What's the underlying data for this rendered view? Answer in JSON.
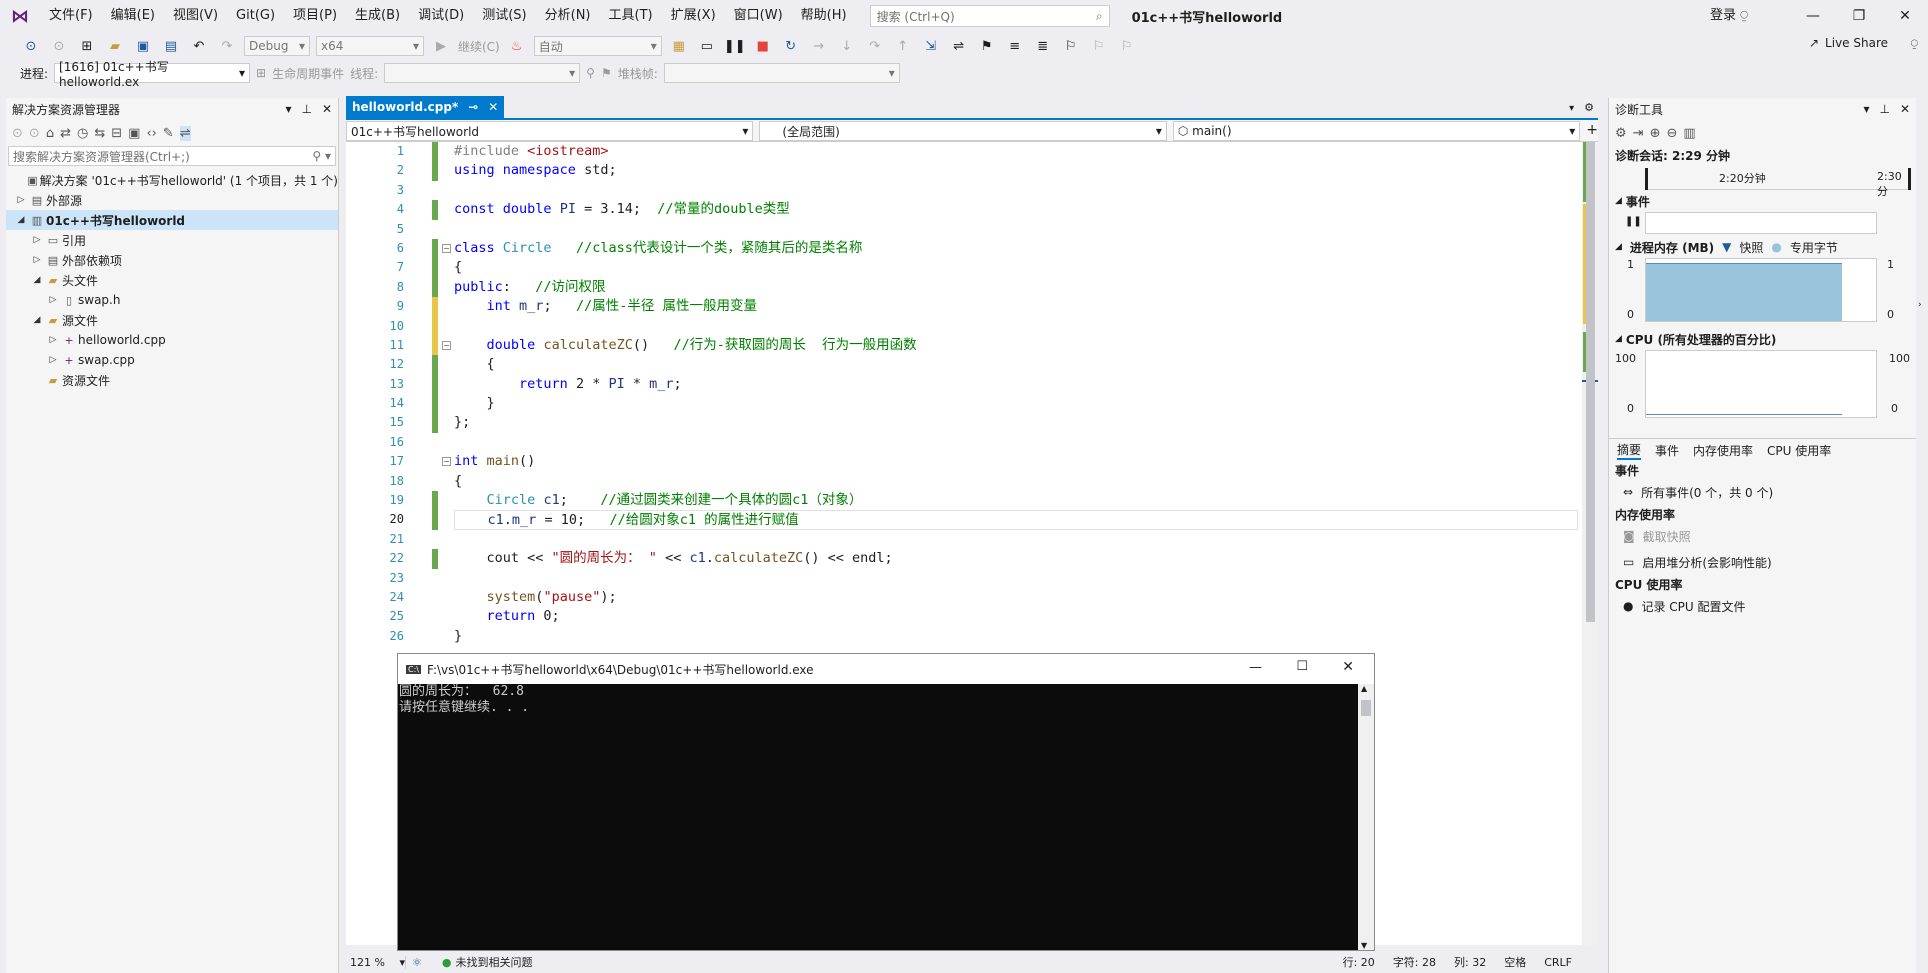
{
  "menu": [
    "文件(F)",
    "编辑(E)",
    "视图(V)",
    "Git(G)",
    "项目(P)",
    "生成(B)",
    "调试(D)",
    "测试(S)",
    "分析(N)",
    "工具(T)",
    "扩展(X)",
    "窗口(W)",
    "帮助(H)"
  ],
  "search": {
    "placeholder": "搜索 (Ctrl+Q)"
  },
  "app_title": "01c++书写helloworld",
  "login": "登录",
  "toolbar": {
    "config": "Debug",
    "platform": "x64",
    "continue": "继续(C)",
    "auto": "自动",
    "live_share": "Live Share"
  },
  "toolbar2": {
    "process_label": "进程:",
    "process_value": "[1616] 01c++书写helloworld.ex",
    "lifecycle": "生命周期事件",
    "thread_label": "线程:",
    "stack_label": "堆栈帧:"
  },
  "solution_explorer": {
    "title": "解决方案资源管理器",
    "search_placeholder": "搜索解决方案资源管理器(Ctrl+;)",
    "items": [
      {
        "label": "解决方案 '01c++书写helloworld' (1 个项目，共 1 个)",
        "indent": 0,
        "arrow": "",
        "icon": "▣"
      },
      {
        "label": "外部源",
        "indent": 0,
        "arrow": "▷",
        "icon": "▤"
      },
      {
        "label": "01c++书写helloworld",
        "indent": 0,
        "arrow": "◢",
        "icon": "▥",
        "selected": true
      },
      {
        "label": "引用",
        "indent": 1,
        "arrow": "▷",
        "icon": "▭"
      },
      {
        "label": "外部依赖项",
        "indent": 1,
        "arrow": "▷",
        "icon": "▤"
      },
      {
        "label": "头文件",
        "indent": 1,
        "arrow": "◢",
        "icon": "▰"
      },
      {
        "label": "swap.h",
        "indent": 2,
        "arrow": "▷",
        "icon": "▯"
      },
      {
        "label": "源文件",
        "indent": 1,
        "arrow": "◢",
        "icon": "▰"
      },
      {
        "label": "helloworld.cpp",
        "indent": 2,
        "arrow": "▷",
        "icon": "+"
      },
      {
        "label": "swap.cpp",
        "indent": 2,
        "arrow": "▷",
        "icon": "+"
      },
      {
        "label": "资源文件",
        "indent": 1,
        "arrow": "",
        "icon": "▰"
      }
    ]
  },
  "editor": {
    "tab": "helloworld.cpp*",
    "nav_project": "01c++书写helloworld",
    "nav_scope": "(全局范围)",
    "nav_member": "main()",
    "current_line": 20,
    "line_count": 26,
    "zoom": "121 %",
    "issues": "未找到相关问题",
    "status_line": "行: 20",
    "status_char": "字符: 28",
    "status_col": "列: 32",
    "status_space": "空格",
    "status_eol": "CRLF"
  },
  "console": {
    "title": "F:\\vs\\01c++书写helloworld\\x64\\Debug\\01c++书写helloworld.exe",
    "line1": "圆的周长为：  62.8",
    "line2": "请按任意键继续. . ."
  },
  "diagnostics": {
    "title": "诊断工具",
    "session": "诊断会话: 2:29 分钟",
    "time_tick1": "2:20分钟",
    "time_tick2": "2:30分",
    "events": "事件",
    "memory_title": "进程内存 (MB)",
    "legend_snapshot": "快照",
    "legend_private": "专用字节",
    "memory_max": "1",
    "memory_min": "0",
    "cpu_title": "CPU (所有处理器的百分比)",
    "cpu_max": "100",
    "cpu_min": "0",
    "tabs": [
      "摘要",
      "事件",
      "内存使用率",
      "CPU 使用率"
    ],
    "sec_events": "事件",
    "all_events": "所有事件(0 个，共 0 个)",
    "sec_memory": "内存使用率",
    "take_snapshot": "截取快照",
    "heap_analysis": "启用堆分析(会影响性能)",
    "sec_cpu": "CPU 使用率",
    "record_cpu": "记录 CPU 配置文件"
  }
}
